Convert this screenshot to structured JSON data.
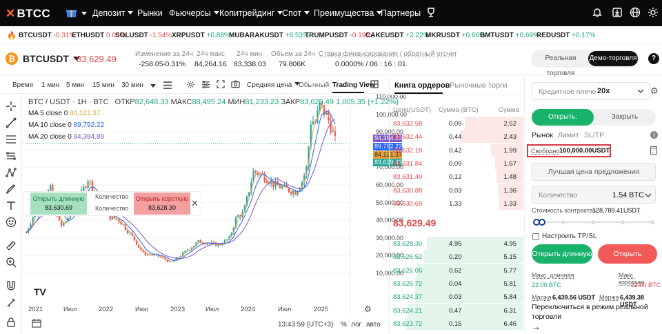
{
  "nav": {
    "logo": "BTCC",
    "items": [
      {
        "label": "Депозит",
        "caret": true
      },
      {
        "label": "Рынки",
        "caret": false
      },
      {
        "label": "Фьючерсы",
        "caret": true
      },
      {
        "label": "Копитрейдинг",
        "caret": true
      },
      {
        "label": "Спот",
        "caret": true
      },
      {
        "label": "Преимущества",
        "caret": true
      },
      {
        "label": "Партнеры",
        "caret": false
      }
    ]
  },
  "ticker": [
    {
      "symbol": "BTCUSDT",
      "change": "-0.31%",
      "dir": "dn"
    },
    {
      "symbol": "ETHUSDT",
      "change": "0.00%",
      "dir": "dn"
    },
    {
      "symbol": "SOLUSDT",
      "change": "-1.54%",
      "dir": "dn"
    },
    {
      "symbol": "XRPUSDT",
      "change": "+0.88%",
      "dir": "up"
    },
    {
      "symbol": "MUBARAKUSDT",
      "change": "+8.53%",
      "dir": "up"
    },
    {
      "symbol": "TRUMPUSDT",
      "change": "-0.19%",
      "dir": "dn"
    },
    {
      "symbol": "CAKEUSDT",
      "change": "+2.22%",
      "dir": "up"
    },
    {
      "symbol": "MKRUSDT",
      "change": "+0.66%",
      "dir": "up"
    },
    {
      "symbol": "BMTUSDT",
      "change": "+0.69%",
      "dir": "up"
    },
    {
      "symbol": "REDUSDT",
      "change": "+0.17%",
      "dir": "up"
    }
  ],
  "symbol": {
    "name": "BTCUSDT",
    "price": "83,629.49",
    "change_label": "Изменение за 24ч",
    "change_abs": "-258.05",
    "change_pct": "-0.31%",
    "high_label": "24ч макс",
    "high": "84,264.16",
    "low_label": "24ч мин",
    "low": "83,338.03",
    "vol_label": "Объем за 24ч",
    "vol": "79.806K",
    "funding_label": "Ставка финансирования / обратный отсчет",
    "funding": "0.0000% / 06 : 16 : 01",
    "real_btn": "Реальная торговля",
    "demo_btn": "Демо-торговля"
  },
  "toolbar": {
    "intervals": [
      "Время",
      "1 мин",
      "5 мин",
      "15 мин",
      "30 мин"
    ],
    "price_type": "Средняя цена",
    "view_normal": "Обычный",
    "view_tv": "Trading View"
  },
  "chart": {
    "header": "BTC / USDT · 1H · BTC",
    "ohlc_o_label": "ОТКР",
    "ohlc_o": "82,648.33",
    "ohlc_h_label": "МАКС",
    "ohlc_h": "88,495.24",
    "ohlc_l_label": "МИН",
    "ohlc_l": "81,233.23",
    "ohlc_c_label": "ЗАКР",
    "ohlc_c": "83,629.49",
    "ohlc_chg": "1,005.35 (+1.22%)",
    "ma5_label": "MA 5 close 0",
    "ma5": "84,121.37",
    "ma10_label": "MA 10 close 0",
    "ma10": "89,792.22",
    "ma20_label": "MA 20 close 0",
    "ma20": "94,394.89",
    "price_tags": [
      "94,394.89",
      "89,792.22",
      "84,121.37",
      "83,629.49"
    ],
    "y_ticks": [
      "110,000.00",
      "100,000.00",
      "90,000.00",
      "80,000.00",
      "70,000.00",
      "60,000.00",
      "50,000.00",
      "40,000.00",
      "30,000.00",
      "20,000.00",
      "10,000.00"
    ],
    "x_ticks": [
      "2021",
      "Июл",
      "2022",
      "Июл",
      "2023",
      "Июл",
      "2024",
      "Июл",
      "2025"
    ],
    "time": "13:43:59 (UTC+3)",
    "pct": "%",
    "log": "лог",
    "auto": "авто",
    "colors": {
      "up": "#26a69a",
      "down": "#ef5350",
      "ma5": "#e8a33d",
      "ma10": "#2962ff",
      "ma20": "#7e57c2"
    }
  },
  "quick_trade": {
    "long_label": "Открыть длинную",
    "long_price": "83,630.69",
    "qty_label": "Количество",
    "short_label": "Открыть короткую",
    "short_price": "83,628.30"
  },
  "orderbook": {
    "tab_active": "Книга ордеров",
    "tab_other": "Рыночные торги",
    "col_price": "Цена(USDT)",
    "col_amount": "Сумма (BTC)",
    "col_total": "Сумма",
    "asks": [
      {
        "price": "83,632.58",
        "amount": "0.09",
        "total": "2.52",
        "depth": 0.44
      },
      {
        "price": "83,632.44",
        "amount": "0.44",
        "total": "2.43",
        "depth": 0.47
      },
      {
        "price": "83,632.18",
        "amount": "0.42",
        "total": "1.99",
        "depth": 0.24
      },
      {
        "price": "83,631.84",
        "amount": "0.09",
        "total": "1.57",
        "depth": 0.21
      },
      {
        "price": "83,631.49",
        "amount": "0.12",
        "total": "1.48",
        "depth": 0.2
      },
      {
        "price": "83,630.88",
        "amount": "0.03",
        "total": "1.36",
        "depth": 0.19
      },
      {
        "price": "83,630.69",
        "amount": "1.33",
        "total": "1.33",
        "depth": 0.18
      }
    ],
    "mid_price": "83,629.49",
    "bids": [
      {
        "price": "83,628.30",
        "amount": "4.95",
        "total": "4.95",
        "depth": 0.72
      },
      {
        "price": "83,626.52",
        "amount": "0.20",
        "total": "5.15",
        "depth": 0.74
      },
      {
        "price": "83,626.06",
        "amount": "0.62",
        "total": "5.77",
        "depth": 0.8
      },
      {
        "price": "83,625.72",
        "amount": "0.04",
        "total": "5.81",
        "depth": 0.81
      },
      {
        "price": "83,624.37",
        "amount": "0.03",
        "total": "5.84",
        "depth": 0.81
      },
      {
        "price": "83,624.21",
        "amount": "0.47",
        "total": "6.31",
        "depth": 0.86
      },
      {
        "price": "83,623.72",
        "amount": "0.15",
        "total": "6.46",
        "depth": 0.88
      }
    ]
  },
  "trade": {
    "leverage_label": "Кредитное плечо",
    "leverage": "20x",
    "open_tab": "Открыть:",
    "close_tab": "Закрыть",
    "order_types": [
      "Рынок",
      "Лимит",
      "SL/TP"
    ],
    "free_label": "Свободно",
    "free_value": "100,000.00USDT",
    "best_price": "Лучшая цена предложения",
    "qty_label": "Количество",
    "qty_value": "1.54",
    "qty_unit": "BTC",
    "contract_label": "Стоимость контракта≈",
    "contract_value": "128,789.41USDT",
    "tpsl_label": "Настроить TP/SL",
    "long_btn": "Открыть длинную",
    "short_btn": "Открыть короткую",
    "max_long_label": "Макс. длинная",
    "max_long": "22.00 BTC",
    "max_short_label": "Макс. короткая",
    "max_short": "22.00 BTC",
    "margin_label": "Маржа",
    "margin_long": "6,439.56 USDT",
    "margin_short": "6,439.38 USDT",
    "switch_text": "Переключиться в режим реальной торговли",
    "arrow": "→"
  }
}
